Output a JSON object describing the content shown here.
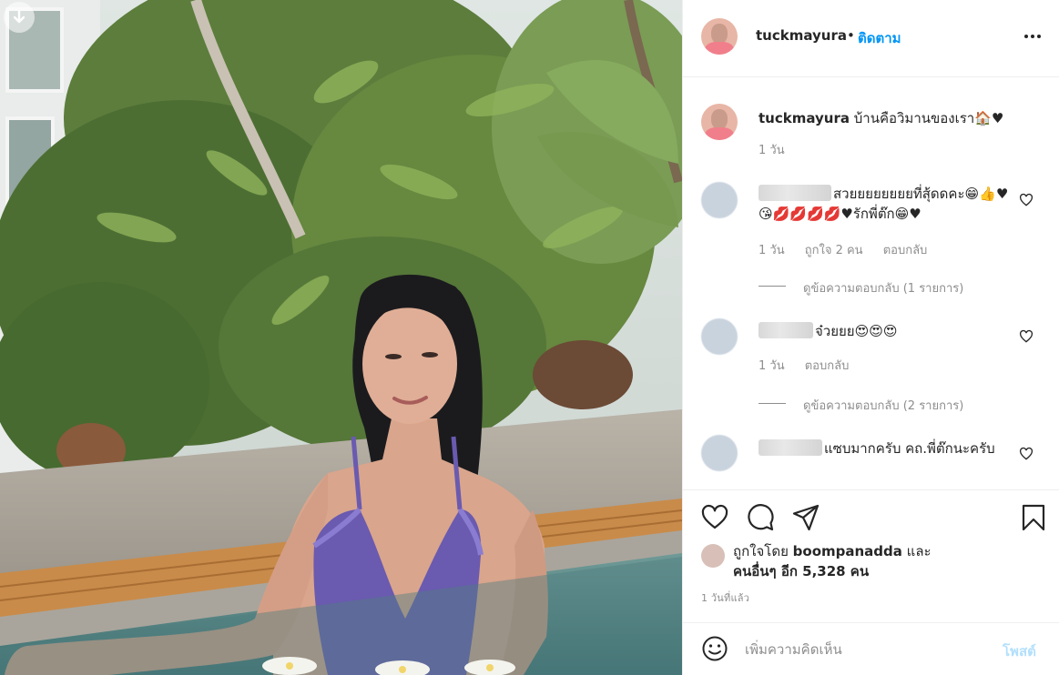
{
  "post": {
    "username": "tuckmayura",
    "dot": "•",
    "follow_label": "ติดตาม",
    "caption_username": "tuckmayura",
    "caption_text": "บ้านคือวิมานของเรา🏠♥",
    "caption_time": "1 วัน"
  },
  "comments": [
    {
      "text": "สวยยยยยยยยที่สุ้ดดคะ😁👍♥😘💋💋💋💋♥รักพี่ต๊ก😁♥",
      "time": "1 วัน",
      "likes": "ถูกใจ 2 คน",
      "reply_label": "ตอบกลับ",
      "view_replies": "ดูข้อความตอบกลับ (1 รายการ)"
    },
    {
      "text": "จ๋วยยย😍😍😍",
      "time": "1 วัน",
      "reply_label": "ตอบกลับ",
      "view_replies": "ดูข้อความตอบกลับ (2 รายการ)"
    },
    {
      "text": "แซบมากครับ คถ.พี่ต๊กนะครับ"
    }
  ],
  "likes": {
    "prefix": "ถูกใจโดย",
    "liker": "boompanadda",
    "and": "และ",
    "others": "คนอื่นๆ อีก 5,328 คน"
  },
  "time_ago": "1 วันที่แล้ว",
  "add_comment": {
    "placeholder": "เพิ่มความคิดเห็น",
    "post_label": "โพสต์"
  },
  "icons": {
    "download": "download-arrow-icon",
    "more": "more-options-icon",
    "heart": "heart-icon",
    "comment": "comment-bubble-icon",
    "share": "paper-plane-icon",
    "save": "bookmark-icon",
    "emoji": "smiley-face-icon"
  },
  "colors": {
    "accent": "#0095f6",
    "post_disabled": "#b2dffc",
    "muted": "#8e8e8e",
    "text": "#262626"
  }
}
